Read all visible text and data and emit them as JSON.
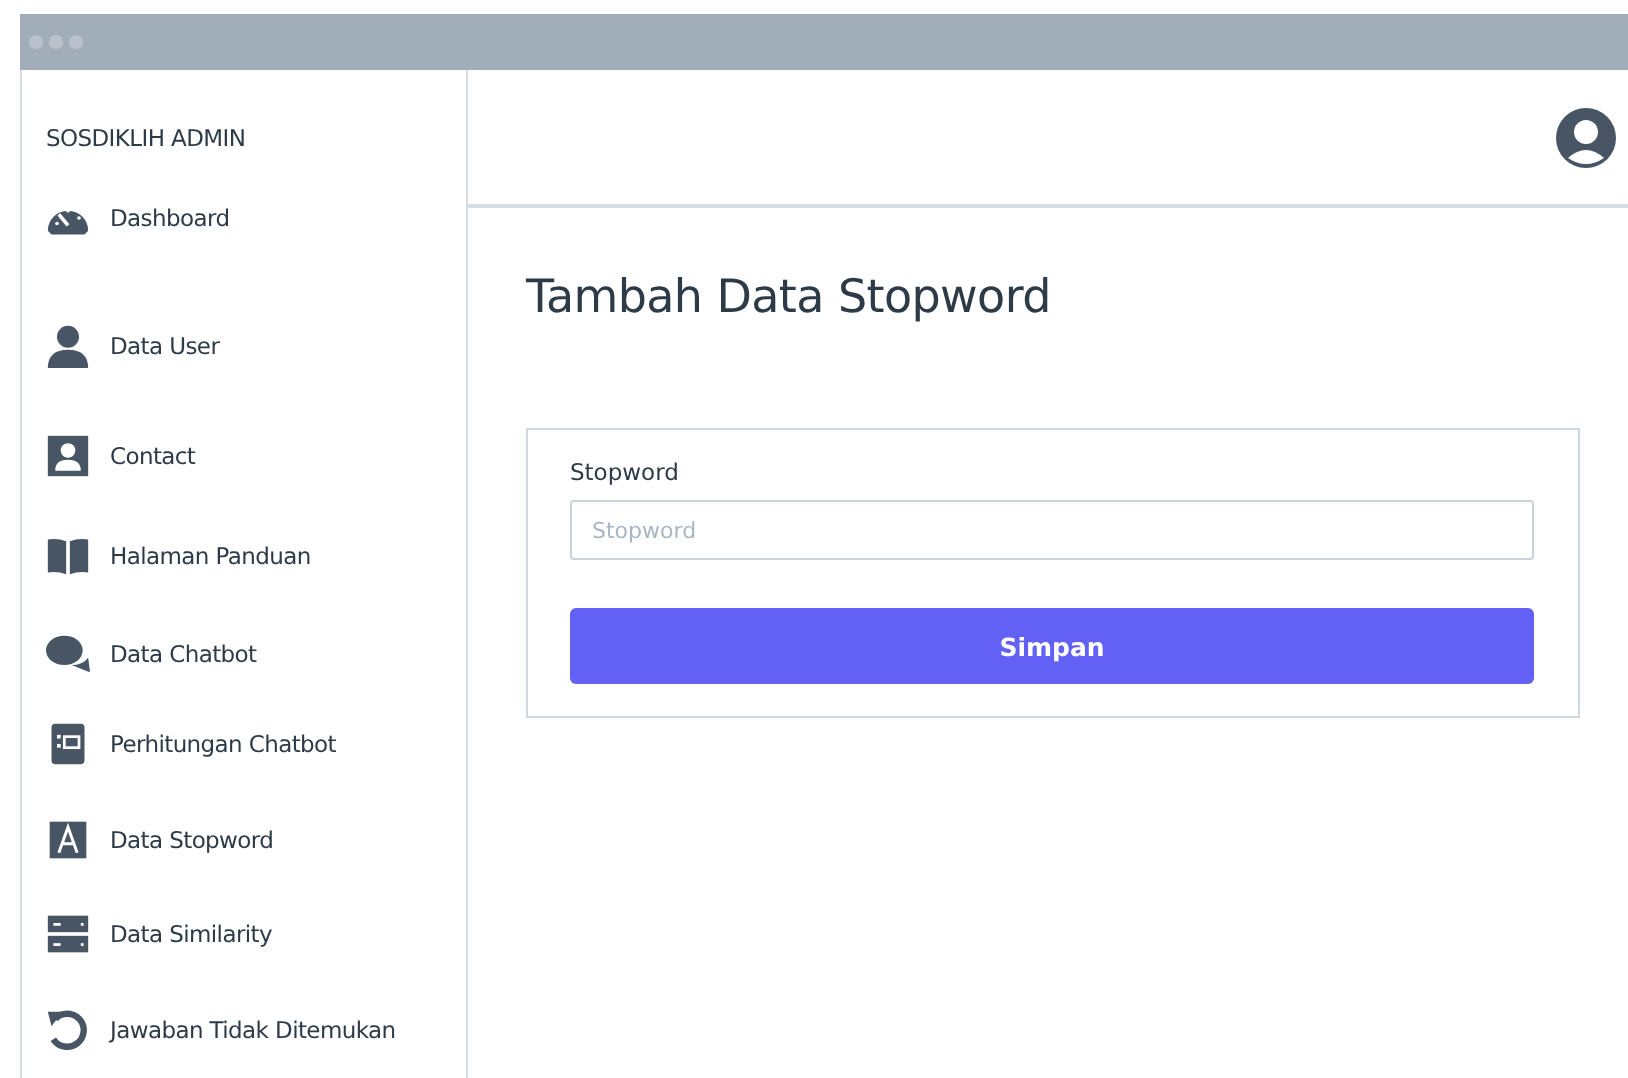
{
  "sidebar": {
    "title": "SOSDIKLIH ADMIN",
    "items": [
      {
        "label": "Dashboard"
      },
      {
        "label": "Data User"
      },
      {
        "label": "Contact"
      },
      {
        "label": "Halaman Panduan"
      },
      {
        "label": "Data Chatbot"
      },
      {
        "label": "Perhitungan Chatbot"
      },
      {
        "label": "Data Stopword"
      },
      {
        "label": "Data Similarity"
      },
      {
        "label": "Jawaban Tidak Ditemukan"
      }
    ]
  },
  "page": {
    "title": "Tambah Data Stopword"
  },
  "form": {
    "label": "Stopword",
    "placeholder": "Stopword",
    "button": "Simpan"
  }
}
